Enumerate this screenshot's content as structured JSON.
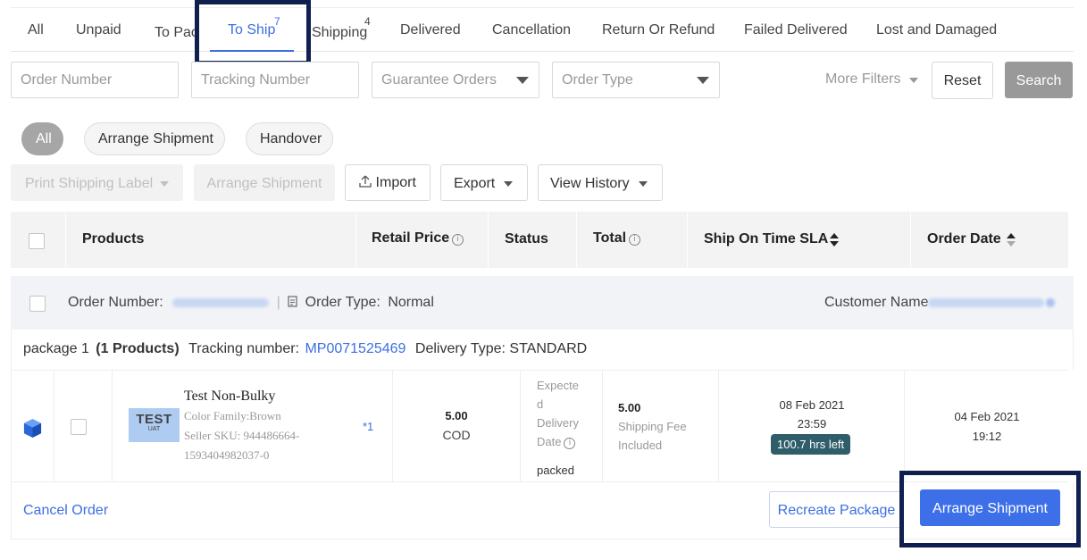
{
  "tabs": [
    {
      "label": "All"
    },
    {
      "label": "Unpaid"
    },
    {
      "label": "To Pac"
    },
    {
      "label": "To Ship",
      "count": "7",
      "active": true
    },
    {
      "label": "Shipping",
      "count": "4"
    },
    {
      "label": "Delivered"
    },
    {
      "label": "Cancellation"
    },
    {
      "label": "Return Or Refund"
    },
    {
      "label": "Failed Delivered"
    },
    {
      "label": "Lost and Damaged"
    }
  ],
  "filters": {
    "order_number_placeholder": "Order Number",
    "tracking_number_placeholder": "Tracking Number",
    "guarantee_orders": "Guarantee Orders",
    "order_type": "Order Type",
    "more_filters": "More Filters",
    "reset": "Reset",
    "search": "Search"
  },
  "pills": [
    "All",
    "Arrange Shipment",
    "Handover"
  ],
  "actions": {
    "print_label": "Print Shipping Label",
    "arrange_shipment": "Arrange Shipment",
    "import": "Import",
    "export": "Export",
    "view_history": "View History"
  },
  "table_headers": {
    "products": "Products",
    "retail_price": "Retail Price",
    "status": "Status",
    "total": "Total",
    "sla": "Ship On Time SLA",
    "order_date": "Order Date"
  },
  "order": {
    "number_label": "Order Number:",
    "type_label": "Order Type:",
    "type_value": "Normal",
    "customer_label": "Customer Name",
    "package_label": "package 1",
    "products_count": "(1 Products)",
    "tracking_label": "Tracking number:",
    "tracking_value": "MP0071525469",
    "delivery_label": "Delivery Type: STANDARD",
    "item": {
      "name": "Test Non-Bulky",
      "thumb_text": "TEST",
      "thumb_sub": "UAT",
      "color_family": "Color Family:Brown",
      "seller_sku_1": "Seller SKU: 944486664-",
      "seller_sku_2": "1593404982037-0",
      "qty": "*1",
      "price": "5.00",
      "payment": "COD",
      "status_line1": "Expecte",
      "status_line2": "d",
      "status_line3": "Delivery",
      "status_line4": "Date",
      "status_value": "packed",
      "total": "5.00",
      "total_note1": "Shipping Fee",
      "total_note2": "Included",
      "sla_date": "08 Feb 2021",
      "sla_time": "23:59",
      "sla_left": "100.7 hrs left",
      "order_date": "04 Feb 2021",
      "order_time": "19:12"
    },
    "cancel": "Cancel Order",
    "recreate": "Recreate Package",
    "arrange": "Arrange Shipment"
  },
  "icons": {
    "info": "ⓘ",
    "cube": "cube-icon",
    "upload": "upload-icon",
    "document": "document-icon"
  },
  "colors": {
    "accent": "#3d6fe0",
    "highlight_border": "#0f1f4e",
    "sla_badge": "#2f5e6a"
  }
}
